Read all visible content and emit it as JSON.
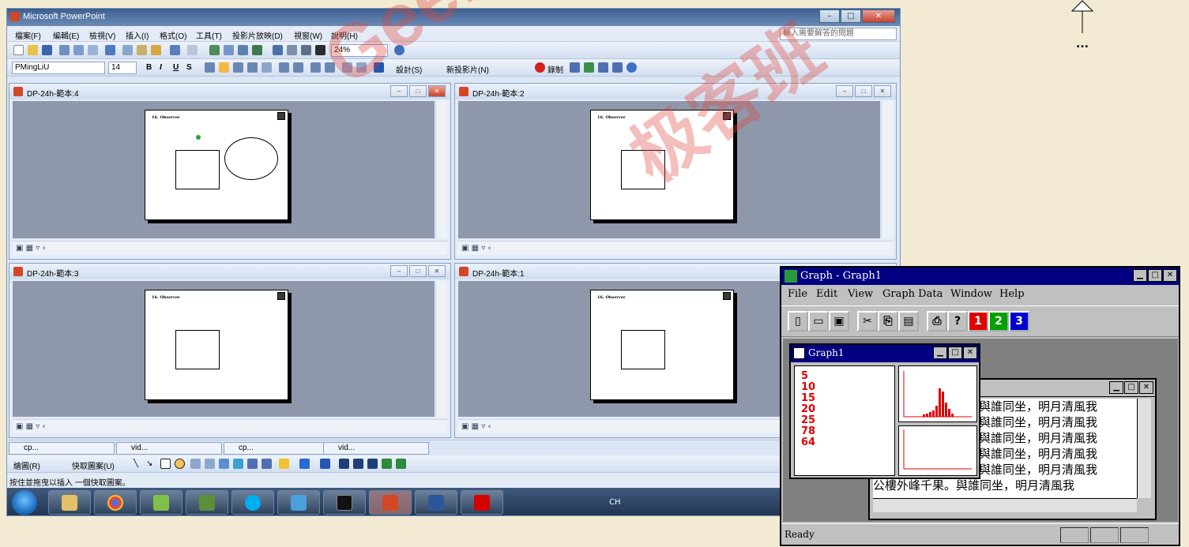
{
  "powerpoint": {
    "title": "Microsoft PowerPoint",
    "menu": [
      "檔案(F)",
      "編輯(E)",
      "檢視(V)",
      "插入(I)",
      "格式(O)",
      "工具(T)",
      "投影片放映(D)",
      "視窗(W)",
      "說明(H)"
    ],
    "help_placeholder": "輸入需要解答的問題",
    "zoom": "24%",
    "font_name": "PMingLiU",
    "font_size": "14",
    "design_label": "設計(S)",
    "new_slide_label": "新投影片(N)",
    "record_label": "錄制",
    "windows": [
      {
        "title": "DP-24h-範本:4",
        "slide_title": "16. Observer"
      },
      {
        "title": "DP-24h-範本:2",
        "slide_title": "16. Observer"
      },
      {
        "title": "DP-24h-範本:3",
        "slide_title": "16. Observer"
      },
      {
        "title": "DP-24h-範本:1",
        "slide_title": "16. Observer"
      }
    ],
    "mini_tabs": [
      "cp...",
      "vid...",
      "cp...",
      "vid..."
    ],
    "draw_label": "繪圖(R)",
    "autoshapes_label": "快取圖案(U)",
    "status": "按住並拖曳以插入 一個快取圖案。",
    "taskbar_lang": "CH"
  },
  "graph_app": {
    "title": "Graph - Graph1",
    "menu": [
      "File",
      "Edit",
      "View",
      "Graph Data",
      "Window",
      "Help"
    ],
    "toolbar_numbers": [
      "1",
      "2",
      "3"
    ],
    "child_title": "Graph1",
    "values": [
      "5",
      "10",
      "15",
      "20",
      "25",
      "78",
      "64"
    ],
    "text_lines": [
      "與誰同坐，明月清風我",
      "與誰同坐，明月清風我",
      "與誰同坐，明月清風我",
      "與誰同坐，明月清風我",
      "與誰同坐，明月清風我",
      "與誰同坐，明月清風我"
    ],
    "last_line_prefix": "公樓外峰千果。",
    "status": "Ready"
  },
  "watermark": {
    "latin": "GeekBand",
    "cn": "极客班"
  },
  "corner_dots": "..."
}
